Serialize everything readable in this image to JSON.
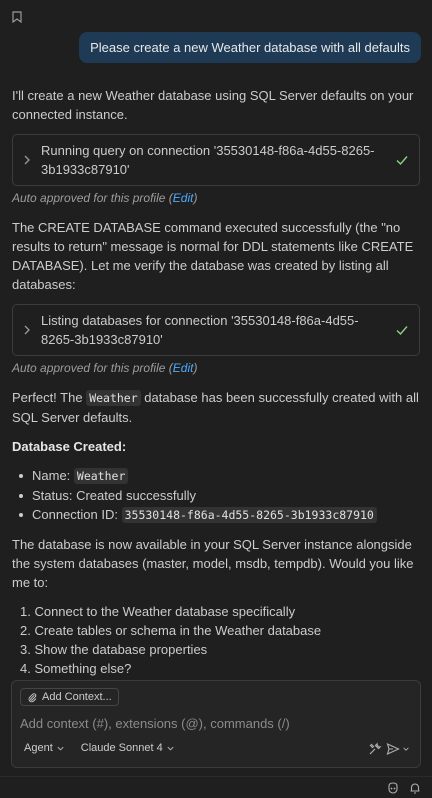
{
  "user_message": "Please create a new Weather database with all defaults",
  "assistant": {
    "intro": "I'll create a new Weather database using SQL Server defaults on your connected instance.",
    "tool1": "Running query on connection '35530148-f86a-4d55-8265-3b1933c87910'",
    "auto_text": "Auto approved for this profile (",
    "auto_link": "Edit",
    "auto_close": ")",
    "para2": "The CREATE DATABASE command executed successfully (the \"no results to return\" message is normal for DDL statements like CREATE DATABASE). Let me verify the database was created by listing all databases:",
    "tool2": "Listing databases for connection '35530148-f86a-4d55-8265-3b1933c87910'",
    "perfect_pre": "Perfect! The ",
    "perfect_code": "Weather",
    "perfect_post": " database has been successfully created with all SQL Server defaults.",
    "heading": "Database Created:",
    "bullets": {
      "name_label": "Name: ",
      "name_value": "Weather",
      "status": "Status: Created successfully",
      "conn_label": "Connection ID: ",
      "conn_value": "35530148-f86a-4d55-8265-3b1933c87910"
    },
    "para3": "The database is now available in your SQL Server instance alongside the system databases (master, model, msdb, tempdb). Would you like me to:",
    "options": [
      "1. Connect to the Weather database specifically",
      "2. Create tables or schema in the Weather database",
      "3. Show the database properties",
      "4. Something else?"
    ]
  },
  "icons": {
    "bookmark": "bookmark-icon",
    "chevron": "chevron-right-icon",
    "check": "check-icon",
    "retry": "retry-icon",
    "undo": "undo-icon",
    "thumbs_up": "thumbs-up-icon",
    "thumbs_down": "thumbs-down-icon",
    "attach": "paperclip-icon",
    "tools": "tools-icon",
    "send": "send-icon",
    "copilot": "copilot-icon",
    "bell": "bell-icon"
  },
  "input": {
    "add_context": "Add Context...",
    "placeholder": "Add context (#), extensions (@), commands (/)",
    "mode": "Agent",
    "model": "Claude Sonnet 4"
  },
  "colors": {
    "background": "#1f1f1f",
    "user_bubble": "#1e3a55",
    "link": "#4daafc",
    "check": "#89d185"
  }
}
